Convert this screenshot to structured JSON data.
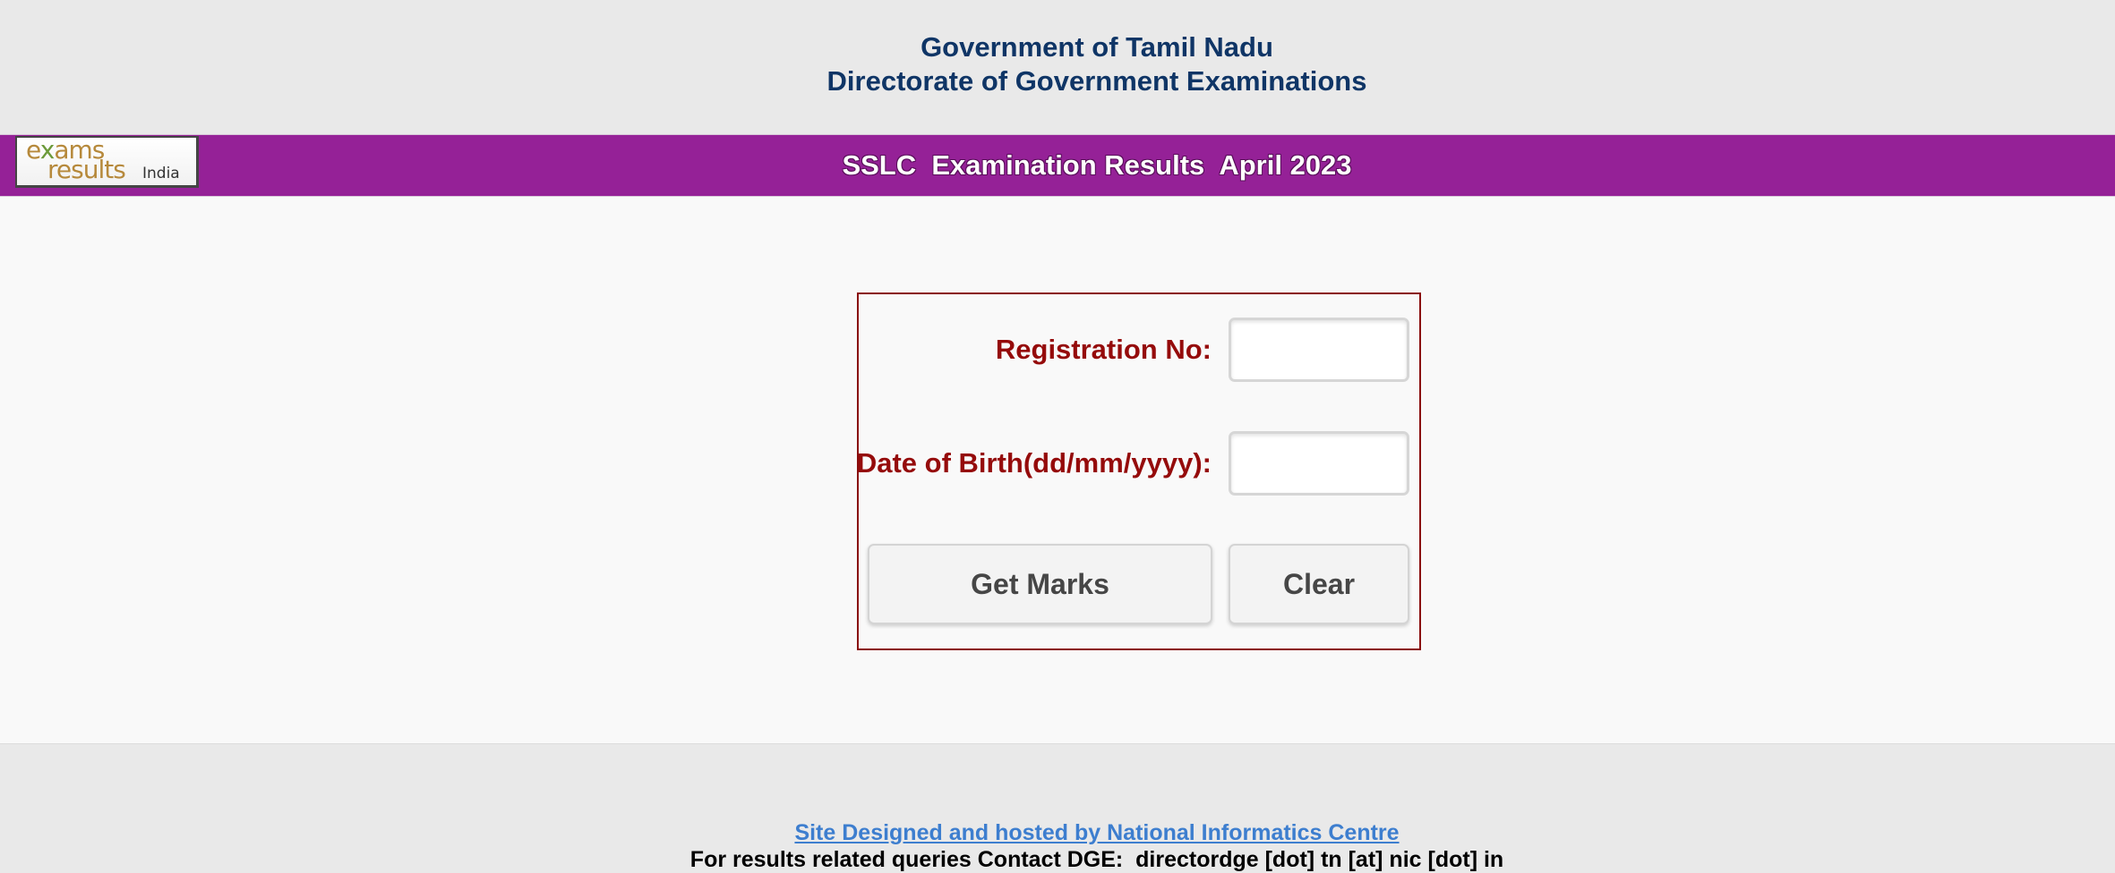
{
  "header": {
    "line1": "Government of Tamil Nadu",
    "line2": "Directorate of Government Examinations"
  },
  "banner": {
    "title": "SSLC  Examination Results  April 2023",
    "logo": {
      "line1_a": "e",
      "line1_x": "x",
      "line1_b": "ams",
      "line2": "results",
      "line3": "India"
    }
  },
  "form": {
    "registration_label": "Registration No:",
    "registration_value": "",
    "dob_label": "Date of Birth(dd/mm/yyyy):",
    "dob_value": "",
    "get_marks_label": "Get Marks",
    "clear_label": "Clear"
  },
  "footer": {
    "nic_link": "Site Designed and hosted by National Informatics Centre",
    "contact": "For results related queries Contact DGE:  directordge [dot] tn [at] nic [dot] in"
  },
  "colors": {
    "banner": "#952197",
    "header_text": "#0f3566",
    "label_text": "#950b0b",
    "link": "#3d7ecf"
  }
}
